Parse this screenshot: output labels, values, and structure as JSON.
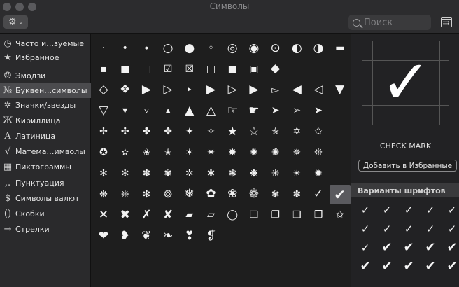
{
  "window": {
    "title": "Символы"
  },
  "toolbar": {
    "gear_glyph": "⚙",
    "chevron_glyph": "⌄",
    "search_placeholder": "Поиск",
    "palette_icon": "character-palette-icon"
  },
  "sidebar": {
    "selected_index": 3,
    "items": [
      {
        "icon_char": "◷",
        "icon": "clock-icon",
        "label": "Часто и…зуемые"
      },
      {
        "icon_char": "★",
        "icon": "star-icon",
        "label": "Избранное"
      },
      {
        "icon_char": "☺",
        "icon": "smiley-icon",
        "label": "Эмодзи"
      },
      {
        "icon_char": "№",
        "icon": "numero-icon",
        "label": "Буквен…символы"
      },
      {
        "icon_char": "✲",
        "icon": "asterisk-icon",
        "label": "Значки/звезды"
      },
      {
        "icon_char": "Ж",
        "icon": "cyrillic-icon",
        "label": "Кириллица"
      },
      {
        "icon_char": "A",
        "icon": "latin-icon",
        "label": "Латиница"
      },
      {
        "icon_char": "√",
        "icon": "square-root-icon",
        "label": "Матема…имволы"
      },
      {
        "icon_char": "▦",
        "icon": "pictogram-icon",
        "label": "Пиктограммы"
      },
      {
        "icon_char": ",.",
        "icon": "punctuation-icon",
        "label": "Пунктуация"
      },
      {
        "icon_char": "$",
        "icon": "dollar-icon",
        "label": "Символы валют"
      },
      {
        "icon_char": "()",
        "icon": "parentheses-icon",
        "label": "Скобки"
      },
      {
        "icon_char": "→",
        "icon": "arrow-icon",
        "label": "Стрелки"
      }
    ]
  },
  "grid": {
    "selected": [
      7,
      11
    ],
    "rows": [
      [
        "·",
        "•",
        "∙",
        "○",
        "●",
        "◦",
        "◎",
        "◉",
        "⊙",
        "◐",
        "◑",
        "▬"
      ],
      [
        "▪",
        "■",
        "□",
        "☑",
        "☒",
        "□",
        "■",
        "▣",
        "◆"
      ],
      [
        "◇",
        "❖",
        "▶",
        "▷",
        "‣",
        "▶",
        "▷",
        "▶",
        "▻",
        "◀",
        "◁",
        "▼"
      ],
      [
        "▽",
        "▾",
        "▿",
        "▴",
        "▲",
        "△",
        "☞",
        "☛",
        "➤",
        "➢",
        "➤"
      ],
      [
        "✢",
        "✣",
        "✤",
        "✥",
        "✦",
        "✧",
        "★",
        "☆",
        "✯",
        "✡",
        "✩"
      ],
      [
        "✪",
        "✫",
        "✬",
        "✭",
        "✶",
        "✷",
        "✸",
        "✹",
        "✺",
        "✵",
        "❊"
      ],
      [
        "✻",
        "✼",
        "✽",
        "✾",
        "✲",
        "✱",
        "❃",
        "❉",
        "✳",
        "✴",
        "✹"
      ],
      [
        "❋",
        "❈",
        "❇",
        "❂",
        "❄",
        "✿",
        "❀",
        "❁",
        "✾",
        "✽",
        "✓",
        "✔"
      ],
      [
        "✕",
        "✖",
        "✗",
        "✘",
        "▰",
        "▱",
        "◯",
        "❏",
        "❐",
        "❑",
        "❒",
        "✩"
      ],
      [
        "❤",
        "❥",
        "❦",
        "❧",
        "❣",
        "❡"
      ]
    ]
  },
  "detail": {
    "glyph": "✓",
    "name": "CHECK MARK",
    "add_favorites_label": "Добавить в Избранные",
    "variants_header": "Варианты шрифтов",
    "variants": [
      "✓",
      "✓",
      "✓",
      "✓",
      "✓",
      "✓",
      "✓",
      "✓",
      "✓",
      "✓",
      "✓",
      "✔",
      "✔",
      "✔",
      "✔",
      "✔",
      "✔",
      "✔",
      "✔",
      "✔"
    ]
  }
}
